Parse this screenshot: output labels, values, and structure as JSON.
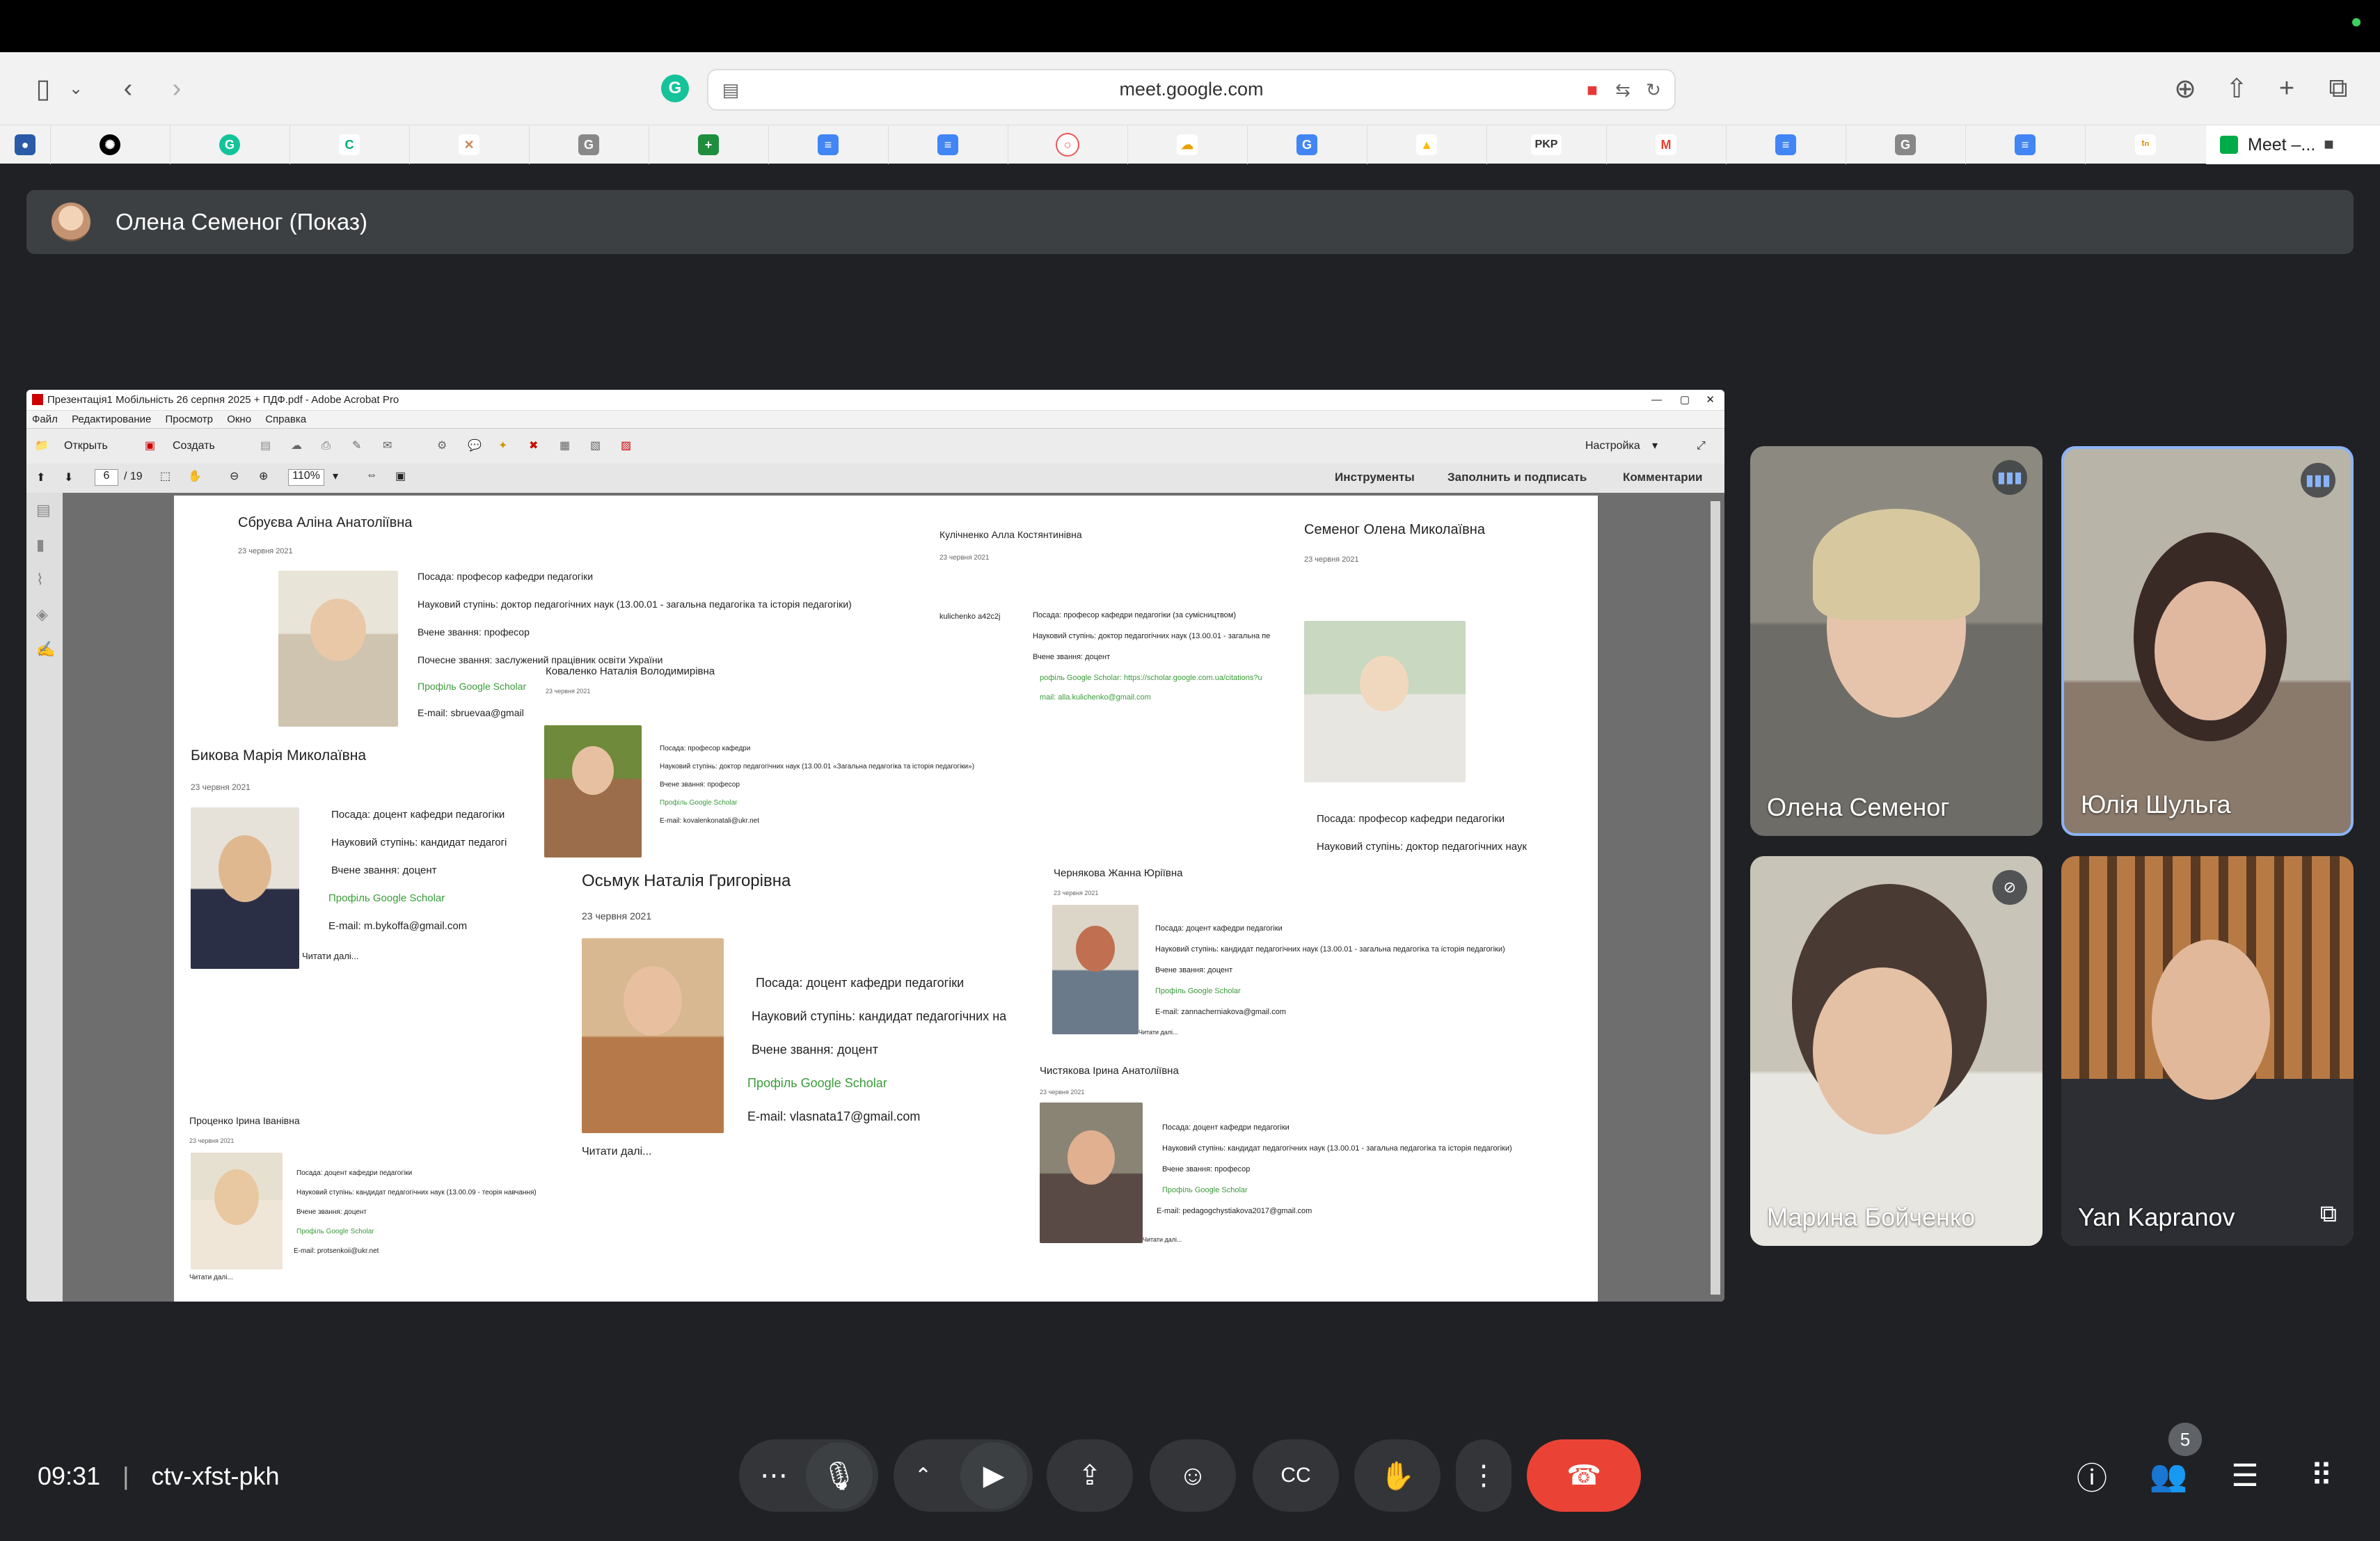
{
  "browser": {
    "url": "meet.google.com",
    "last_tab_label": "Meet –...",
    "bookmark_icons": [
      "chatgpt",
      "grammarly",
      "c-app",
      "hammer",
      "g-app",
      "sheets",
      "docs",
      "docs",
      "duo",
      "cloud",
      "translate",
      "drive",
      "pkp",
      "gmail",
      "docs",
      "g-app",
      "docs",
      "tn"
    ],
    "bookmark_pkp": "PKP"
  },
  "meeting": {
    "presenter_label": "Олена Семеног (Показ)",
    "time": "09:31",
    "separator": "|",
    "code": "ctv-xfst-pkh",
    "participant_count": "5"
  },
  "acrobat": {
    "title": "Презентація1 Мобільність  26 серпня  2025 + ПДФ.pdf - Adobe Acrobat Pro",
    "menu": [
      "Файл",
      "Редактирование",
      "Просмотр",
      "Окно",
      "Справка"
    ],
    "open_label": "Открыть",
    "create_label": "Создать",
    "customize_label": "Настройка",
    "page_current": "6",
    "page_total": "/ 19",
    "zoom": "110%",
    "tools_label": "Инструменты",
    "fill_sign_label": "Заполнить и подписать",
    "comments_label": "Комментарии"
  },
  "doc": {
    "p1_name": "Сбруєва Аліна Анатоліївна",
    "p1_date": "23 червня 2021",
    "p1_pos": "Посада: професор кафедри педагогіки",
    "p1_deg": "Науковий ступінь: доктор педагогічних наук (13.00.01 - загальна педагогіка та історія педагогіки)",
    "p1_title": "Вчене звання: професор",
    "p1_hon": "Почесне звання: заслужений працівник освіти України",
    "p1_scholar": "Профіль Google Scholar",
    "p1_email": "E-mail: sbruevaa@gmail",
    "p2_name": "Кулічненко Алла Костянтинівна",
    "p2_date": "23 червня 2021",
    "p2_img": "kulichenko a42c2j",
    "p2_pos": "Посада: професор кафедри педагогіки (за сумісництвом)",
    "p2_deg": "Науковий ступінь: доктор педагогічних наук (13.00.01 - загальна пе",
    "p2_title": "Вчене звання: доцент",
    "p2_scholar": "рофіль Google Scholar:  https://scholar.google.com.ua/citations?u",
    "p2_email": "mail: alla.kulichenko@gmail.com",
    "p3_name": "Семеног Олена Миколаївна",
    "p3_date": "23 червня 2021",
    "p3_pos": "Посада: професор кафедри педагогіки",
    "p3_deg": "Науковий ступінь: доктор педагогічних наук",
    "p4_name": "Коваленко Наталія Володимирівна",
    "p4_date": "23 червня 2021",
    "p4_pos": "Посада: професор кафедри",
    "p4_deg": "Науковий ступінь: доктор педагогічних наук (13.00.01 «Загальна педагогіка та історія педагогіки»)",
    "p4_title": "Вчене звання: професор",
    "p4_scholar": "Профіль Google Scholar",
    "p4_email": "E-mail: kovalenkonatali@ukr.net",
    "p5_name": "Бикова Марія Миколаївна",
    "p5_date": "23 червня 2021",
    "p5_pos": "Посада: доцент кафедри педагогіки",
    "p5_deg": "Науковий ступінь: кандидат педагогі",
    "p5_title": "Вчене звання: доцент",
    "p5_scholar": "Профіль Google Scholar",
    "p5_email": "E-mail: m.bykoffa@gmail.com",
    "p5_more": "Читати далі...",
    "p6_name": "Осьмук Наталія Григорівна",
    "p6_date": "23 червня 2021",
    "p6_pos": "Посада: доцент кафедри педагогіки",
    "p6_deg": "Науковий ступінь: кандидат педагогічних на",
    "p6_title": "Вчене звання: доцент",
    "p6_scholar": "Профіль Google Scholar",
    "p6_email": "E-mail: vlasnata17@gmail.com",
    "p6_more": "Читати далі...",
    "p7_name": "Чернякова Жанна Юріївна",
    "p7_date": "23 червня 2021",
    "p7_pos": "Посада: доцент кафедри педагогіки",
    "p7_deg": "Науковий ступінь: кандидат педагогічних наук (13.00.01 - загальна педагогіка та історія педагогіки)",
    "p7_title": "Вчене звання: доцент",
    "p7_scholar": "Профіль Google Scholar",
    "p7_email": "E-mail: zannacherniakova@gmail.com",
    "p7_more": "Читати далі...",
    "p8_name": "Проценко Ірина Іванівна",
    "p8_date": "23 червня 2021",
    "p8_pos": "Посада: доцент кафедри педагогіки",
    "p8_deg": "Науковий ступінь: кандидат педагогічних наук (13.00.09 - теорія навчання)",
    "p8_title": "Вчене звання: доцент",
    "p8_scholar": "Профіль Google Scholar",
    "p8_email": "E-mail: protsenkoii@ukr.net",
    "p8_more": "Читати далі...",
    "p9_name": "Чистякова Ірина Анатоліївна",
    "p9_date": "23 червня 2021",
    "p9_pos": "Посада: доцент кафедри педагогіки",
    "p9_deg": "Науковий ступінь: кандидат педагогічних наук (13.00.01 - загальна педагогіка та історія педагогіки)",
    "p9_title": "Вчене звання: професор",
    "p9_scholar": "Профіль Google Scholar",
    "p9_email": "E-mail: pedagogchystiakova2017@gmail.com",
    "p9_more": "Читати далі..."
  },
  "participants": [
    {
      "name": "Олена Семеног"
    },
    {
      "name": "Юлія Шульга"
    },
    {
      "name": "Марина Бойченко"
    },
    {
      "name": "Yan Kapranov"
    }
  ],
  "colors": {
    "meet_bg": "#202124",
    "end_call": "#ea4335",
    "link_green": "#3a9b3a",
    "speaking_blue": "#8ab4f8"
  }
}
